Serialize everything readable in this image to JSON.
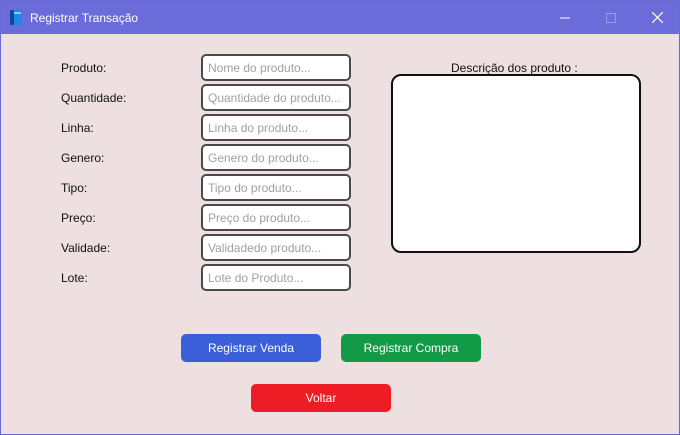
{
  "window": {
    "title": "Registrar Transação",
    "colors": {
      "titlebar": "#6b6bd9",
      "background": "#eedfe0"
    }
  },
  "form": {
    "fields": [
      {
        "label": "Produto:",
        "placeholder": "Nome do produto...",
        "value": ""
      },
      {
        "label": "Quantidade:",
        "placeholder": "Quantidade do produto...",
        "value": ""
      },
      {
        "label": "Linha:",
        "placeholder": "Linha do produto...",
        "value": ""
      },
      {
        "label": "Genero:",
        "placeholder": "Genero do produto...",
        "value": ""
      },
      {
        "label": "Tipo:",
        "placeholder": "Tipo do produto...",
        "value": ""
      },
      {
        "label": "Preço:",
        "placeholder": "Preço do produto...",
        "value": ""
      },
      {
        "label": "Validade:",
        "placeholder": "Validadedo produto...",
        "value": ""
      },
      {
        "label": "Lote:",
        "placeholder": "Lote do Produto...",
        "value": ""
      }
    ],
    "description": {
      "label": "Descrição dos produto  :",
      "value": ""
    }
  },
  "buttons": {
    "register_sale": {
      "label": "Registrar Venda",
      "color": "#3a5fd8"
    },
    "register_purchase": {
      "label": "Registrar Compra",
      "color": "#129a47"
    },
    "back": {
      "label": "Voltar",
      "color": "#ee1c24"
    }
  },
  "icons": {
    "app": "app-book-icon",
    "minimize": "minimize-icon",
    "maximize": "maximize-icon",
    "close": "close-icon"
  }
}
